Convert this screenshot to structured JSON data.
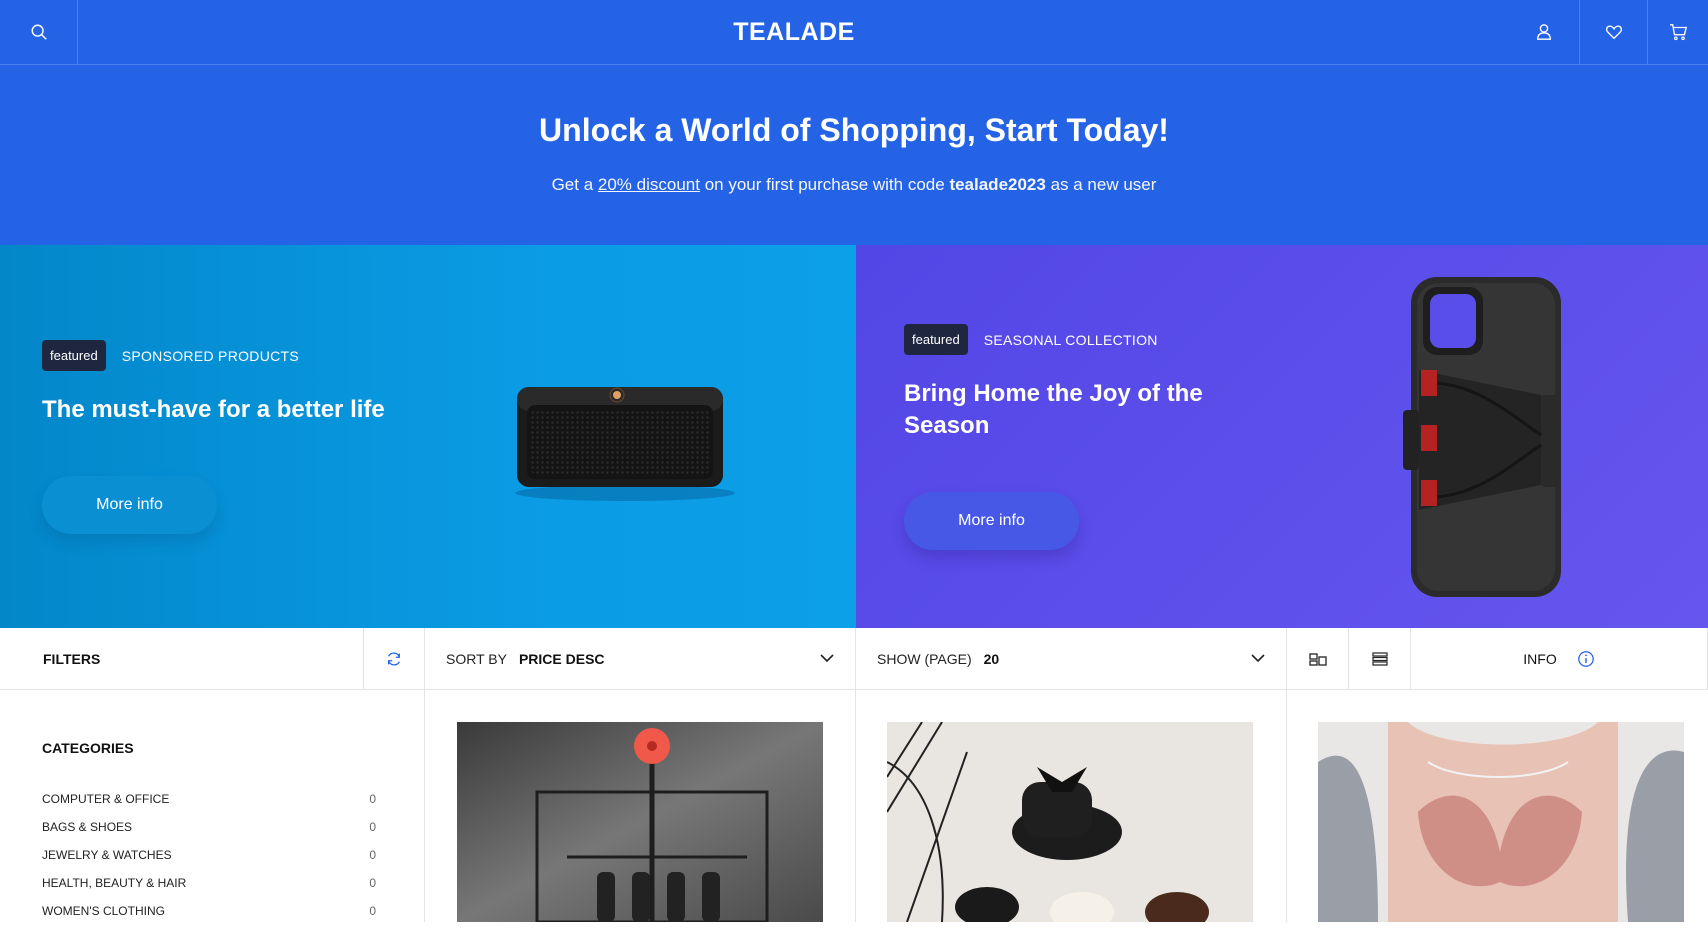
{
  "header": {
    "brand": "TEALADE",
    "icons": [
      "search-icon",
      "user-icon",
      "heart-icon",
      "cart-icon"
    ]
  },
  "promo": {
    "headline": "Unlock a World of Shopping, Start Today!",
    "text_before": "Get a ",
    "discount_link": "20% discount",
    "text_middle": " on your first purchase with code ",
    "code": "tealade2023",
    "text_after": " as a new user"
  },
  "banners": [
    {
      "badge": "featured",
      "label": "SPONSORED PRODUCTS",
      "title": "The must-have for a better life",
      "button": "More info"
    },
    {
      "badge": "featured",
      "label": "SEASONAL COLLECTION",
      "title": "Bring Home the Joy of the Season",
      "button": "More info"
    }
  ],
  "toolbar": {
    "filters": "FILTERS",
    "sort_label": "SORT BY",
    "sort_value": "PRICE DESC",
    "show_label": "SHOW (PAGE)",
    "show_value": "20",
    "info": "INFO"
  },
  "sidebar": {
    "title": "CATEGORIES",
    "categories": [
      {
        "name": "COMPUTER & OFFICE",
        "count": "0"
      },
      {
        "name": "BAGS & SHOES",
        "count": "0"
      },
      {
        "name": "JEWELRY & WATCHES",
        "count": "0"
      },
      {
        "name": "HEALTH, BEAUTY & HAIR",
        "count": "0"
      },
      {
        "name": "WOMEN'S CLOTHING",
        "count": "0"
      }
    ]
  },
  "colors": {
    "primary": "#2563e6",
    "banner_left": "#0a9be4",
    "banner_right": "#5a4eea",
    "badge": "#1f2740"
  }
}
